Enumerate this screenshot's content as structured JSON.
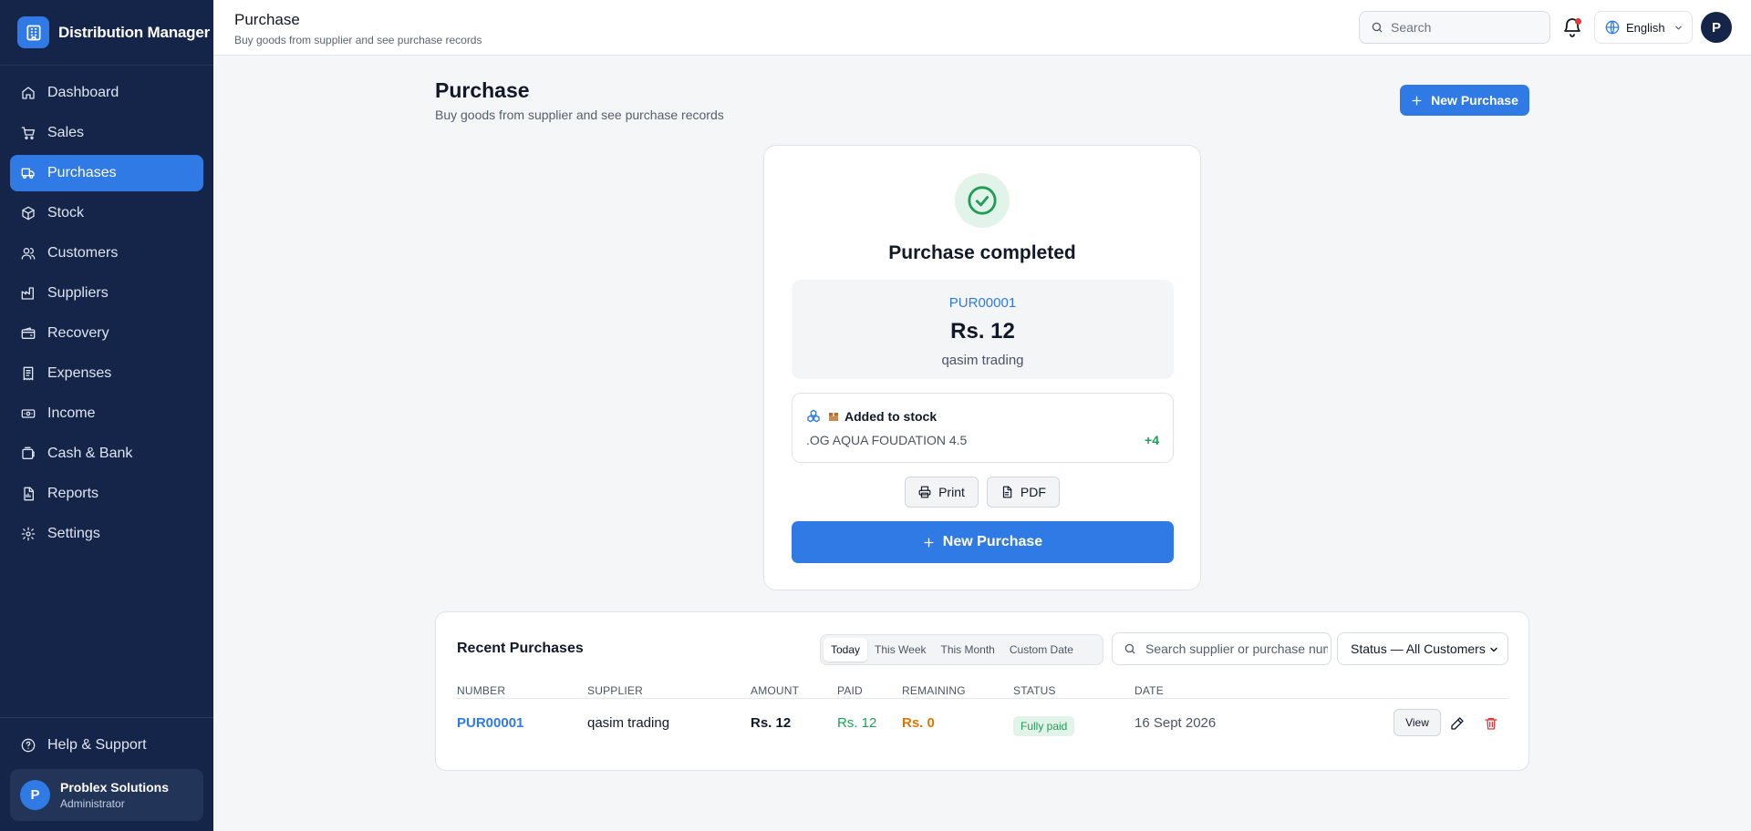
{
  "app": {
    "brand": "Distribution Manager"
  },
  "sidebar": {
    "items": [
      {
        "label": "Dashboard",
        "icon": "home-icon"
      },
      {
        "label": "Sales",
        "icon": "cart-icon"
      },
      {
        "label": "Purchases",
        "icon": "truck-icon"
      },
      {
        "label": "Stock",
        "icon": "box-icon"
      },
      {
        "label": "Customers",
        "icon": "users-icon"
      },
      {
        "label": "Suppliers",
        "icon": "factory-icon"
      },
      {
        "label": "Recovery",
        "icon": "wallet-icon"
      },
      {
        "label": "Expenses",
        "icon": "receipt-icon"
      },
      {
        "label": "Income",
        "icon": "banknote-icon"
      },
      {
        "label": "Cash & Bank",
        "icon": "bank-icon"
      },
      {
        "label": "Reports",
        "icon": "report-icon"
      },
      {
        "label": "Settings",
        "icon": "gear-icon"
      }
    ],
    "active": "Purchases",
    "help_label": "Help & Support",
    "user": {
      "initial": "P",
      "name": "Problex Solutions",
      "role": "Administrator"
    }
  },
  "topbar": {
    "title": "Purchase",
    "subtitle": "Buy goods from supplier and see purchase records",
    "search_placeholder": "Search",
    "language": "English",
    "avatar_initial": "P"
  },
  "page": {
    "title": "Purchase",
    "subtitle": "Buy goods from supplier and see purchase records",
    "new_purchase_label": "New Purchase"
  },
  "completion": {
    "heading": "Purchase completed",
    "number": "PUR00001",
    "amount": "Rs. 12",
    "supplier": "qasim trading",
    "stock_heading": "Added to stock",
    "stock_item": ".OG AQUA FOUDATION 4.5",
    "stock_qty": "+4",
    "print_label": "Print",
    "pdf_label": "PDF",
    "new_purchase_label": "New Purchase"
  },
  "recent": {
    "title": "Recent Purchases",
    "tabs": [
      "Today",
      "This Week",
      "This Month",
      "Custom Date"
    ],
    "active_tab": "Today",
    "search_placeholder": "Search supplier or purchase number",
    "status_filter": "Status — All Customers",
    "columns": [
      "NUMBER",
      "SUPPLIER",
      "AMOUNT",
      "PAID",
      "REMAINING",
      "STATUS",
      "DATE"
    ],
    "rows": [
      {
        "number": "PUR00001",
        "supplier": "qasim trading",
        "amount": "Rs. 12",
        "paid": "Rs. 12",
        "remaining": "Rs. 0",
        "status": "Fully paid",
        "date": "16 Sept 2026",
        "view_label": "View"
      }
    ]
  },
  "colors": {
    "sidebar_bg": "#152449",
    "accent": "#2f7ae5",
    "success": "#1f9d55",
    "warning": "#d97706",
    "danger": "#e5383b"
  }
}
